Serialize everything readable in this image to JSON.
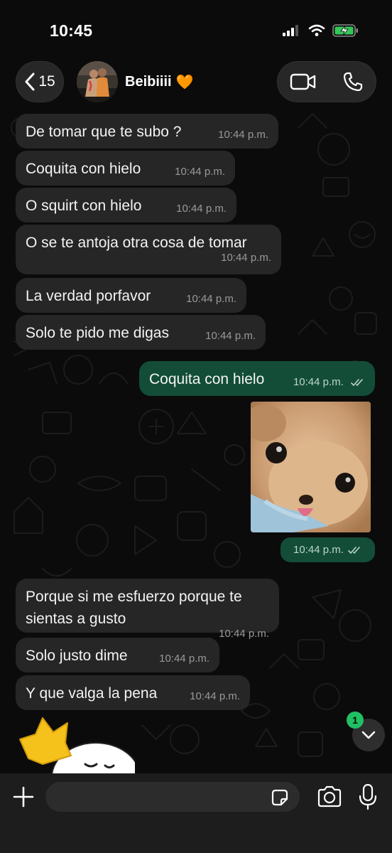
{
  "status_bar": {
    "time": "10:45"
  },
  "header": {
    "back_count": "15",
    "contact_name": "Beibiiii",
    "contact_emoji": "🧡",
    "icons": [
      "chevron-left-icon",
      "video-call-icon",
      "phone-icon"
    ]
  },
  "messages": [
    {
      "direction": "in",
      "text": "De tomar que te subo ?",
      "time": "10:44 p.m."
    },
    {
      "direction": "in",
      "text": "Coquita con hielo",
      "time": "10:44 p.m."
    },
    {
      "direction": "in",
      "text": "O squirt con hielo",
      "time": "10:44 p.m."
    },
    {
      "direction": "in",
      "text": "O se te antoja otra cosa de tomar",
      "time": "10:44 p.m."
    },
    {
      "direction": "in",
      "text": "La verdad porfavor",
      "time": "10:44 p.m."
    },
    {
      "direction": "in",
      "text": "Solo te pido me digas",
      "time": "10:44 p.m."
    },
    {
      "direction": "out",
      "text": "Coquita con hielo",
      "time": "10:44 p.m.",
      "status": "read"
    },
    {
      "direction": "out",
      "type": "image",
      "image": "plush-toy-photo",
      "time": "10:44 p.m.",
      "status": "read"
    },
    {
      "direction": "in",
      "text": "Porque si me esfuerzo porque te sientas a gusto",
      "time": "10:44 p.m."
    },
    {
      "direction": "in",
      "text": "Solo justo dime",
      "time": "10:44 p.m."
    },
    {
      "direction": "in",
      "text": "Y que valga la pena",
      "time": "10:44 p.m."
    },
    {
      "direction": "in",
      "type": "sticker",
      "image": "crown-character-sticker"
    }
  ],
  "scroll_button": {
    "unread_count": "1"
  },
  "composer": {
    "placeholder": "",
    "value": ""
  },
  "colors": {
    "background": "#0b0b0b",
    "incoming_bubble": "#262626",
    "outgoing_bubble": "#134d37",
    "accent_green": "#21c063"
  }
}
